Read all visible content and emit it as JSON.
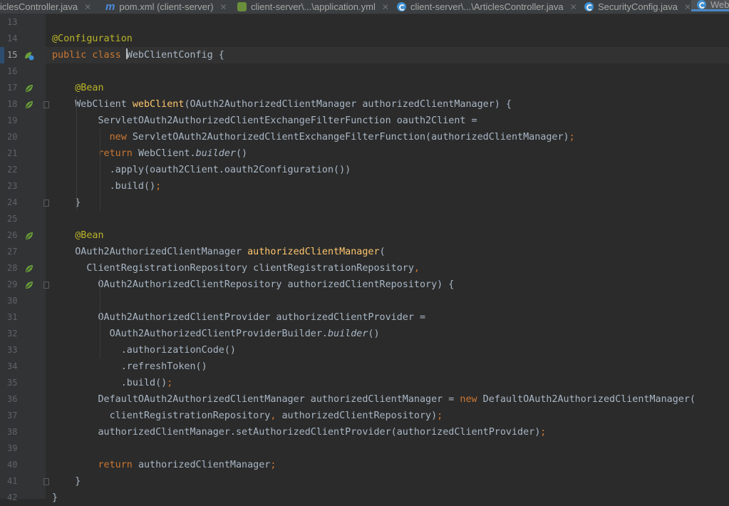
{
  "tabs": [
    {
      "label": "iclesController.java",
      "icon": "none",
      "active": false
    },
    {
      "label": "pom.xml (client-server)",
      "icon": "maven-icon",
      "active": false
    },
    {
      "label": "client-server\\...\\application.yml",
      "icon": "yaml-icon",
      "active": false
    },
    {
      "label": "client-server\\...\\ArticlesController.java",
      "icon": "class-icon",
      "active": false
    },
    {
      "label": "SecurityConfig.java",
      "icon": "class-icon",
      "active": false
    },
    {
      "label": "Web",
      "icon": "class-icon",
      "active": true
    }
  ],
  "editor": {
    "current_line": 15,
    "lines": [
      {
        "n": "13",
        "tokens": []
      },
      {
        "n": "14",
        "tokens": [
          [
            "an",
            "@Configuration"
          ]
        ]
      },
      {
        "n": "15",
        "tokens": [
          [
            "kw",
            "public class "
          ],
          [
            "caret",
            "W"
          ],
          [
            "",
            "ebClientConfig {"
          ]
        ]
      },
      {
        "n": "16",
        "tokens": []
      },
      {
        "n": "17",
        "tokens": [
          [
            "an",
            "    @Bean"
          ]
        ]
      },
      {
        "n": "18",
        "tokens": [
          [
            "",
            "    WebClient "
          ],
          [
            "fn",
            "webClient"
          ],
          [
            "",
            "(OAuth2AuthorizedClientManager authorizedClientManager) {"
          ]
        ]
      },
      {
        "n": "19",
        "tokens": [
          [
            "",
            "        ServletOAuth2AuthorizedClientExchangeFilterFunction oauth2Client ="
          ]
        ]
      },
      {
        "n": "20",
        "tokens": [
          [
            "kw",
            "          new "
          ],
          [
            "",
            "ServletOAuth2AuthorizedClientExchangeFilterFunction(authorizedClientManager)"
          ],
          [
            "pn",
            ";"
          ]
        ]
      },
      {
        "n": "21",
        "tokens": [
          [
            "kw",
            "        return "
          ],
          [
            "",
            "WebClient."
          ],
          [
            "it",
            "builder"
          ],
          [
            "",
            "()"
          ]
        ]
      },
      {
        "n": "22",
        "tokens": [
          [
            "",
            "          .apply(oauth2Client.oauth2Configuration())"
          ]
        ]
      },
      {
        "n": "23",
        "tokens": [
          [
            "",
            "          .build()"
          ],
          [
            "pn",
            ";"
          ]
        ]
      },
      {
        "n": "24",
        "tokens": [
          [
            "",
            "    }"
          ]
        ]
      },
      {
        "n": "25",
        "tokens": []
      },
      {
        "n": "26",
        "tokens": [
          [
            "an",
            "    @Bean"
          ]
        ]
      },
      {
        "n": "27",
        "tokens": [
          [
            "",
            "    OAuth2AuthorizedClientManager "
          ],
          [
            "fn",
            "authorizedClientManager"
          ],
          [
            "",
            "("
          ]
        ]
      },
      {
        "n": "28",
        "tokens": [
          [
            "",
            "      ClientRegistrationRepository clientRegistrationRepository"
          ],
          [
            "pn",
            ","
          ]
        ]
      },
      {
        "n": "29",
        "tokens": [
          [
            "",
            "        OAuth2AuthorizedClientRepository authorizedClientRepository) {"
          ]
        ]
      },
      {
        "n": "30",
        "tokens": []
      },
      {
        "n": "31",
        "tokens": [
          [
            "",
            "        OAuth2AuthorizedClientProvider authorizedClientProvider ="
          ]
        ]
      },
      {
        "n": "32",
        "tokens": [
          [
            "",
            "          OAuth2AuthorizedClientProviderBuilder."
          ],
          [
            "it",
            "builder"
          ],
          [
            "",
            "()"
          ]
        ]
      },
      {
        "n": "33",
        "tokens": [
          [
            "",
            "            .authorizationCode()"
          ]
        ]
      },
      {
        "n": "34",
        "tokens": [
          [
            "",
            "            .refreshToken()"
          ]
        ]
      },
      {
        "n": "35",
        "tokens": [
          [
            "",
            "            .build()"
          ],
          [
            "pn",
            ";"
          ]
        ]
      },
      {
        "n": "36",
        "tokens": [
          [
            "",
            "        DefaultOAuth2AuthorizedClientManager authorizedClientManager = "
          ],
          [
            "kw",
            "new "
          ],
          [
            "",
            "DefaultOAuth2AuthorizedClientManager("
          ]
        ]
      },
      {
        "n": "37",
        "tokens": [
          [
            "",
            "          clientRegistrationRepository"
          ],
          [
            "pn",
            ", "
          ],
          [
            "",
            "authorizedClientRepository)"
          ],
          [
            "pn",
            ";"
          ]
        ]
      },
      {
        "n": "38",
        "tokens": [
          [
            "",
            "        authorizedClientManager.setAuthorizedClientProvider(authorizedClientProvider)"
          ],
          [
            "pn",
            ";"
          ]
        ]
      },
      {
        "n": "39",
        "tokens": []
      },
      {
        "n": "40",
        "tokens": [
          [
            "kw",
            "        return "
          ],
          [
            "",
            "authorizedClientManager"
          ],
          [
            "pn",
            ";"
          ]
        ]
      },
      {
        "n": "41",
        "tokens": [
          [
            "",
            "    }"
          ]
        ]
      },
      {
        "n": "42",
        "tokens": [
          [
            "",
            "}"
          ]
        ]
      }
    ],
    "gutter_icons": {
      "15": "spring-config-icon",
      "17": "spring-bean-icon",
      "18": "spring-bean-icon",
      "26": "spring-bean-icon",
      "28": "spring-bean-icon",
      "29": "spring-bean-icon"
    },
    "fold_markers": [
      "18",
      "24",
      "29",
      "41"
    ]
  },
  "colors": {
    "keyword": "#cc7832",
    "annotation": "#bbb529",
    "method": "#ffc66d",
    "text": "#a9b7c6",
    "background": "#2b2b2b"
  }
}
